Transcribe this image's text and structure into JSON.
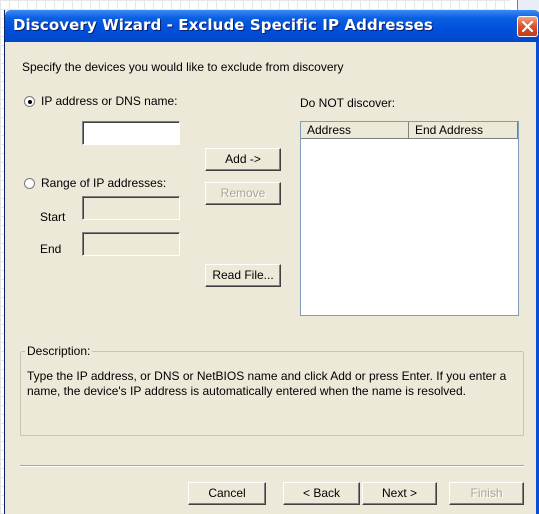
{
  "window": {
    "title": "Discovery Wizard - Exclude Specific IP Addresses"
  },
  "intro": "Specify the devices you would like to exclude from discovery",
  "options": {
    "ip_or_dns_label": "IP address or DNS name:",
    "ip_or_dns_value": "",
    "range_label": "Range of IP addresses:",
    "start_label": "Start",
    "start_value": "",
    "end_label": "End",
    "end_value": "",
    "selected": "ip_or_dns"
  },
  "buttons": {
    "add": "Add ->",
    "remove": "Remove",
    "read_file": "Read File...",
    "cancel": "Cancel",
    "back": "< Back",
    "next": "Next >",
    "finish": "Finish"
  },
  "exclude_list": {
    "label": "Do NOT discover:",
    "columns": [
      "Address",
      "End Address"
    ],
    "rows": []
  },
  "description": {
    "title": "Description:",
    "text": "Type the IP address, or DNS or NetBIOS name and click Add or press Enter. If you enter a name, the device's IP address is automatically entered when the name is resolved."
  },
  "colors": {
    "titlebar": "#0050dc",
    "dialog_bg": "#ece9d8",
    "close_button": "#d8502c"
  },
  "icons": {
    "close": "close-icon"
  }
}
